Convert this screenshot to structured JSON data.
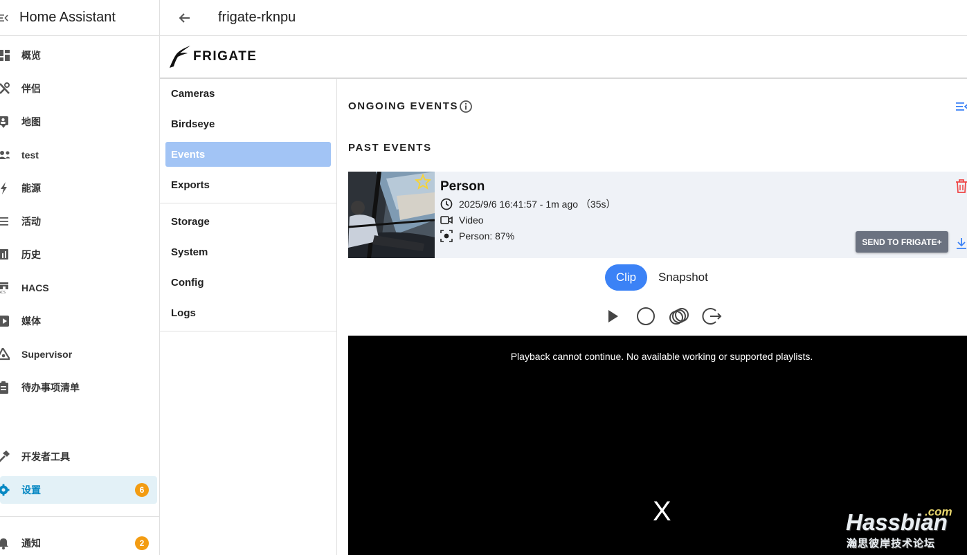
{
  "sidebar": {
    "app_title": "Home Assistant",
    "items": [
      {
        "label": "概览",
        "icon": "dashboard-icon"
      },
      {
        "label": "伴侣",
        "icon": "tools-icon"
      },
      {
        "label": "地图",
        "icon": "map-account-icon"
      },
      {
        "label": "test",
        "icon": "people-icon"
      },
      {
        "label": "能源",
        "icon": "lightning-icon"
      },
      {
        "label": "活动",
        "icon": "list-icon"
      },
      {
        "label": "历史",
        "icon": "chart-icon"
      },
      {
        "label": "HACS",
        "icon": "hacs-icon"
      },
      {
        "label": "媒体",
        "icon": "play-box-icon"
      },
      {
        "label": "Supervisor",
        "icon": "supervisor-icon"
      },
      {
        "label": "待办事项清单",
        "icon": "clipboard-icon"
      }
    ],
    "dev_tools": {
      "label": "开发者工具",
      "icon": "hammer-icon"
    },
    "settings": {
      "label": "设置",
      "icon": "gear-icon",
      "badge": "6"
    },
    "notifications": {
      "label": "通知",
      "icon": "bell-icon",
      "badge": "2"
    }
  },
  "topbar": {
    "title": "frigate-rknpu"
  },
  "frigate": {
    "brand": "FRIGATE",
    "nav": {
      "cameras": "Cameras",
      "birdseye": "Birdseye",
      "events": "Events",
      "exports": "Exports",
      "storage": "Storage",
      "system": "System",
      "config": "Config",
      "logs": "Logs"
    }
  },
  "main": {
    "ongoing_title": "ONGOING EVENTS",
    "past_title": "PAST EVENTS",
    "event": {
      "label": "Person",
      "time": "2025/9/6 16:41:57 - 1m ago （35s）",
      "media": "Video",
      "score": "Person: 87%",
      "send_button": "SEND TO FRIGATE+"
    },
    "tabs": {
      "clip": "Clip",
      "snapshot": "Snapshot"
    },
    "player": {
      "error": "Playback cannot continue. No available working or supported playlists.",
      "close": "X"
    }
  },
  "watermark": {
    "com": ".com",
    "brand": "Hassbian",
    "sub": "瀚思彼岸技术论坛"
  },
  "colors": {
    "accent": "#3b82f6",
    "active_nav": "#a2c4f5",
    "ha_active": "#0788c3",
    "badge": "#f39c12"
  }
}
